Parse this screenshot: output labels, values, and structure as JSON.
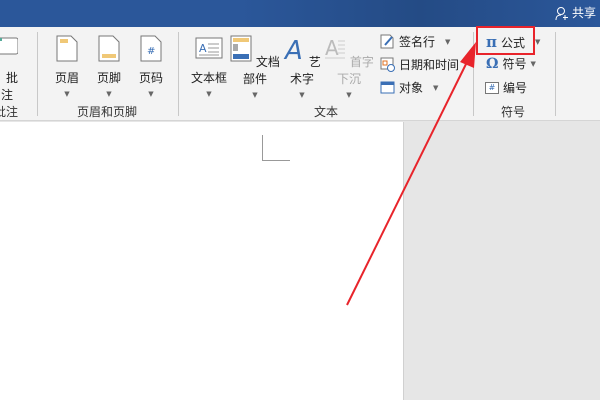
{
  "titlebar": {
    "share": "共享"
  },
  "ribbon": {
    "comment": {
      "label": "批注",
      "group": "批注"
    },
    "header_footer": {
      "group": "页眉和页脚",
      "items": [
        {
          "label": "页眉"
        },
        {
          "label": "页脚"
        },
        {
          "label": "页码"
        }
      ]
    },
    "text": {
      "group": "文本",
      "items": [
        {
          "label": "文本框"
        },
        {
          "label": "文档部件"
        },
        {
          "label": "艺术字"
        },
        {
          "label": "首字下沉"
        }
      ],
      "small": [
        {
          "label": "签名行"
        },
        {
          "label": "日期和时间"
        },
        {
          "label": "对象"
        }
      ]
    },
    "symbols": {
      "group": "符号",
      "items": [
        {
          "label": "公式",
          "icon": "π"
        },
        {
          "label": "符号",
          "icon": "Ω"
        },
        {
          "label": "编号",
          "icon": "#"
        }
      ]
    }
  },
  "colors": {
    "accent": "#2b579a",
    "highlight": "#e8242b"
  }
}
